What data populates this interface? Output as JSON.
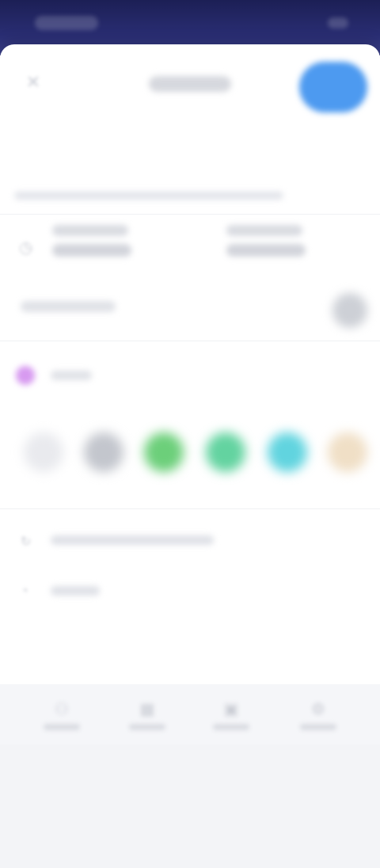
{
  "status_bar": {
    "time": "",
    "icons": ""
  },
  "header": {
    "close_icon": "close-icon",
    "title": "",
    "save_label": ""
  },
  "form": {
    "title_placeholder": "",
    "description_placeholder": ""
  },
  "date_row": {
    "start": {
      "line1": "",
      "line2": ""
    },
    "end": {
      "line1": "",
      "line2": ""
    }
  },
  "all_day": {
    "label": "",
    "enabled": false
  },
  "color": {
    "label": "",
    "selected_color": "#d79af0",
    "swatches": [
      "#e9eaee",
      "#c3c6cd",
      "#6ccf7a",
      "#63d3a0",
      "#61d4df",
      "#f0dfc6"
    ]
  },
  "options": [
    {
      "icon": "repeat-icon",
      "label": ""
    },
    {
      "icon": "bell-icon",
      "label": ""
    }
  ],
  "bottom_nav": [
    {
      "icon": "person-icon",
      "label": ""
    },
    {
      "icon": "calendar-icon",
      "label": ""
    },
    {
      "icon": "briefcase-icon",
      "label": ""
    },
    {
      "icon": "settings-icon",
      "label": ""
    }
  ]
}
